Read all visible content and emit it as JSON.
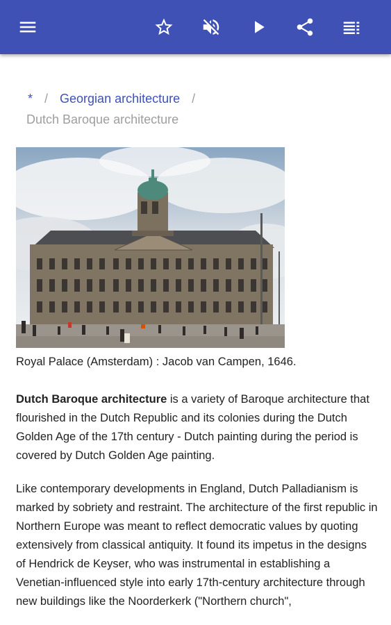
{
  "toolbar": {
    "icons": [
      "menu-icon",
      "star-icon",
      "volume-off-icon",
      "play-icon",
      "share-icon",
      "list-icon"
    ],
    "color": "#3f51b5"
  },
  "breadcrumb": {
    "home": "*",
    "separator": "/",
    "parent": "Georgian architecture",
    "current": "Dutch Baroque architecture"
  },
  "figure": {
    "caption": "Royal Palace (Amsterdam) : Jacob van Campen, 1646."
  },
  "article": {
    "term": "Dutch Baroque architecture",
    "intro_rest": " is a variety of Baroque architecture that flourished in the Dutch Republic and its colonies during the Dutch Golden Age of the 17th century - Dutch painting during the period is covered by Dutch Golden Age painting.",
    "paragraph2": "Like contemporary developments in England, Dutch Palladianism is marked by sobriety and restraint. The architecture of the first republic in Northern Europe was meant to reflect democratic values by quoting extensively from classical antiquity. It found its impetus in the designs of Hendrick de Keyser, who was instrumental in establishing a Venetian-influenced style into early 17th-century architecture through new buildings like the Noorderkerk (\"Northern church\","
  }
}
